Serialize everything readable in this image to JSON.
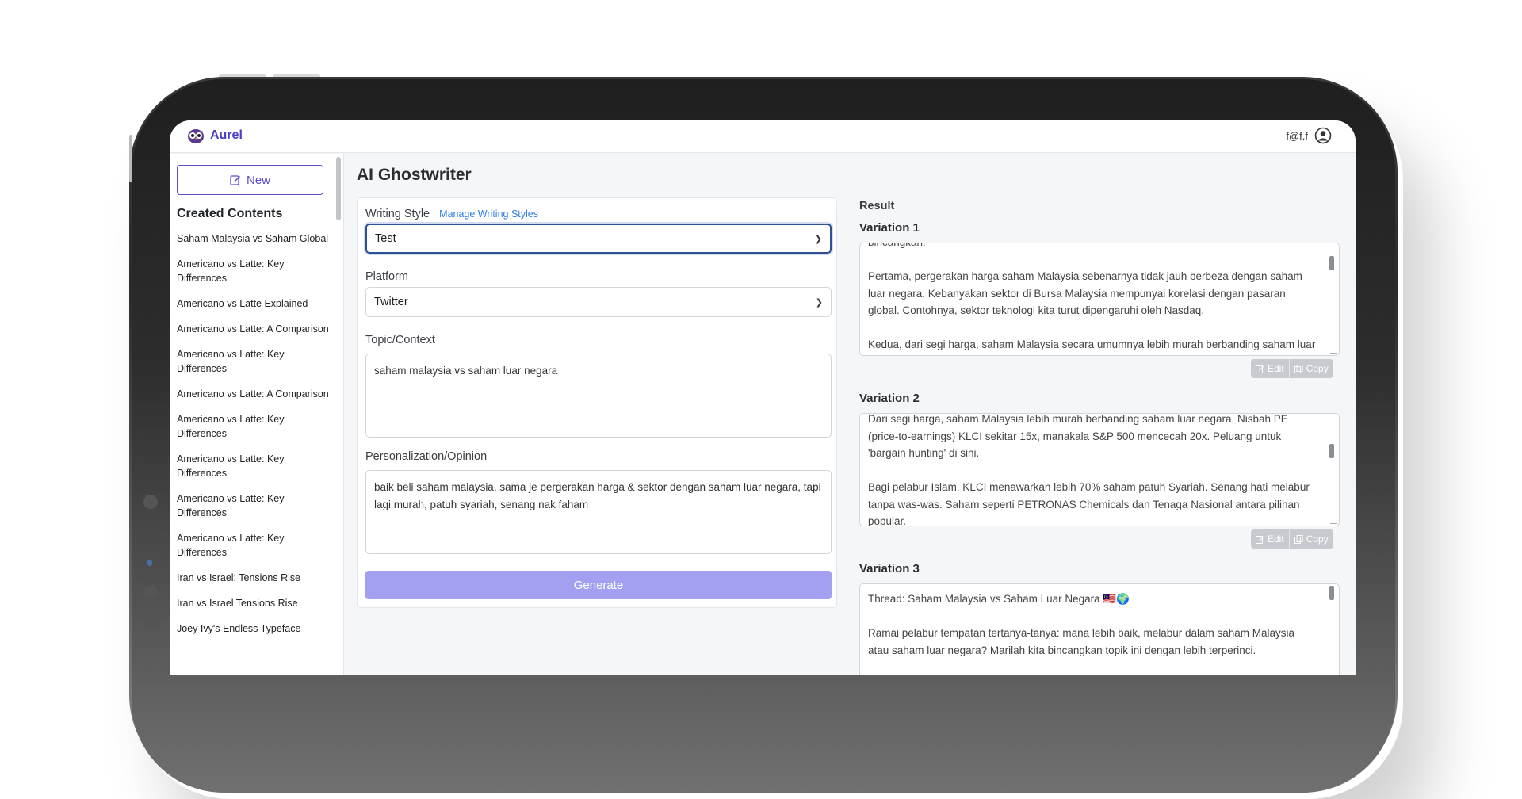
{
  "app": {
    "name": "Aurel",
    "user_email": "f@f.f"
  },
  "sidebar": {
    "new_label": "New",
    "created_title": "Created Contents",
    "items": [
      "Saham Malaysia vs Saham Global",
      "Americano vs Latte: Key Differences",
      "Americano vs Latte Explained",
      "Americano vs Latte: A Comparison",
      "Americano vs Latte: Key Differences",
      "Americano vs Latte: A Comparison",
      "Americano vs Latte: Key Differences",
      "Americano vs Latte: Key Differences",
      "Americano vs Latte: Key Differences",
      "Americano vs Latte: Key Differences",
      "Iran vs Israel: Tensions Rise",
      "Iran vs Israel Tensions Rise",
      "Joey Ivy's Endless Typeface"
    ]
  },
  "main": {
    "title": "AI Ghostwriter",
    "writing_style_label": "Writing Style",
    "manage_link": "Manage Writing Styles",
    "writing_style_value": "Test",
    "platform_label": "Platform",
    "platform_value": "Twitter",
    "topic_label": "Topic/Context",
    "topic_value": "saham malaysia vs saham luar negara",
    "personalization_label": "Personalization/Opinion",
    "personalization_value": "baik beli saham malaysia, sama je pergerakan harga & sektor dengan saham luar negara, tapi lagi murah, patuh syariah, senang nak faham",
    "generate_label": "Generate"
  },
  "result": {
    "label": "Result",
    "edit_label": "Edit",
    "copy_label": "Copy",
    "variations": [
      {
        "label": "Variation 1",
        "text": "bincangkan.\n\nPertama, pergerakan harga saham Malaysia sebenarnya tidak jauh berbeza dengan saham luar negara. Kebanyakan sektor di Bursa Malaysia mempunyai korelasi dengan pasaran global. Contohnya, sektor teknologi kita turut dipengaruhi oleh Nasdaq.\n\nKedua, dari segi harga, saham Malaysia secara umumnya lebih murah berbanding saham luar negara."
      },
      {
        "label": "Variation 2",
        "text": "Dari segi harga, saham Malaysia lebih murah berbanding saham luar negara. Nisbah PE (price-to-earnings) KLCI sekitar 15x, manakala S&P 500 mencecah 20x. Peluang untuk 'bargain hunting' di sini.\n\nBagi pelabur Islam, KLCI menawarkan lebih 70% saham patuh Syariah. Senang hati melabur tanpa was-was. Saham seperti PETRONAS Chemicals dan Tenaga Nasional antara pilihan popular."
      },
      {
        "label": "Variation 3",
        "text": "Thread: Saham Malaysia vs Saham Luar Negara 🇲🇾🌍\n\nRamai pelabur tempatan tertanya-tanya: mana lebih baik, melabur dalam saham Malaysia atau saham luar negara? Marilah kita bincangkan topik ini dengan lebih terperinci."
      }
    ]
  },
  "colors": {
    "accent": "#5a4fd0",
    "generate": "#a3a0f2",
    "link": "#2f7be6"
  }
}
